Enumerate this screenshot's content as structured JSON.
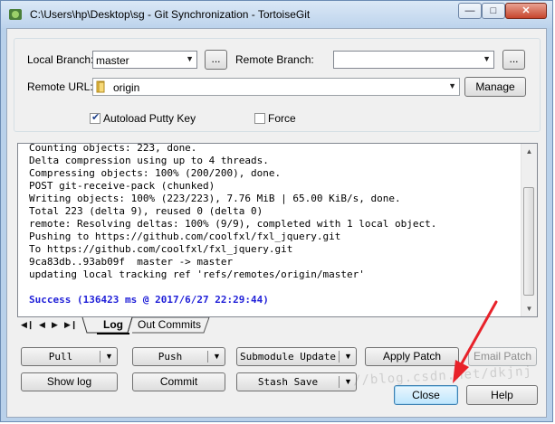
{
  "window": {
    "title": "C:\\Users\\hp\\Desktop\\sg - Git Synchronization - TortoiseGit",
    "min_glyph": "—",
    "max_glyph": "□",
    "close_glyph": "✕"
  },
  "branches": {
    "local_label": "Local Branch:",
    "local_value": "master",
    "browse_label": "...",
    "remote_label": "Remote Branch:",
    "remote_value": "",
    "remote_browse_label": "...",
    "url_label": "Remote URL:",
    "url_value": "origin",
    "manage_label": "Manage",
    "autoload_label": "Autoload Putty Key",
    "autoload_checked": true,
    "force_label": "Force",
    "force_checked": false
  },
  "log": {
    "lines": [
      "Counting objects: 223, done.",
      "Delta compression using up to 4 threads.",
      "Compressing objects: 100% (200/200), done.",
      "POST git-receive-pack (chunked)",
      "Writing objects: 100% (223/223), 7.76 MiB | 65.00 KiB/s, done.",
      "Total 223 (delta 9), reused 0 (delta 0)",
      "remote: Resolving deltas: 100% (9/9), completed with 1 local object.",
      "Pushing to https://github.com/coolfxl/fxl_jquery.git",
      "To https://github.com/coolfxl/fxl_jquery.git",
      "9ca83db..93ab09f  master -> master",
      "updating local tracking ref 'refs/remotes/origin/master'",
      "",
      "Success (136423 ms @ 2017/6/27 22:29:44)"
    ]
  },
  "tabs": {
    "items": [
      "Log",
      "Out Commits"
    ],
    "active": "Log"
  },
  "actions": {
    "pull": "Pull",
    "push": "Push",
    "submodule_update": "Submodule Update",
    "apply_patch": "Apply Patch",
    "email_patch": "Email Patch",
    "show_log": "Show log",
    "commit": "Commit",
    "stash_save": "Stash Save",
    "close": "Close",
    "help": "Help"
  },
  "watermark": "//blog.csdn.net/dkjnj",
  "colors": {
    "success_text": "#1f1fd8",
    "annotation_arrow": "#e8222a",
    "title_bar": "#bcd3ec"
  }
}
